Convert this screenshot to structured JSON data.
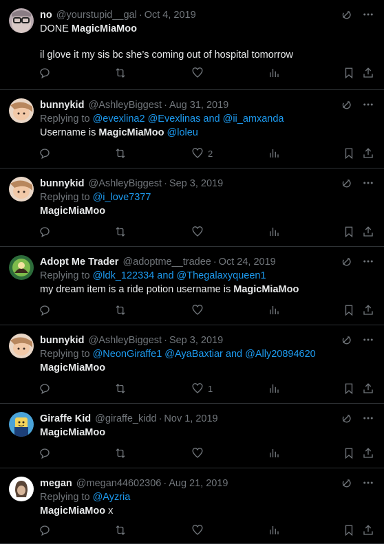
{
  "tweets": [
    {
      "name": "no",
      "handle": "@yourstupid__gal",
      "date": "Oct 4, 2019",
      "reply_prefix": "",
      "reply_to": "",
      "text_prefix": "DONE ",
      "text_bold": "MagicMiaMoo",
      "text_suffix": "",
      "text_line2": "il glove it my sis bc she’s coming out of hospital tomorrow",
      "likes": ""
    },
    {
      "name": "bunnykid",
      "handle": "@AshleyBiggest",
      "date": "Aug 31, 2019",
      "reply_prefix": "Replying to ",
      "reply_to": "@evexlina2 @Evexlinas and @ii_amxanda",
      "text_prefix": "Username is ",
      "text_bold": "MagicMiaMoo",
      "text_suffix": " @loleu",
      "text_line2": "",
      "likes": "2"
    },
    {
      "name": "bunnykid",
      "handle": "@AshleyBiggest",
      "date": "Sep 3, 2019",
      "reply_prefix": "Replying to ",
      "reply_to": "@i_love7377",
      "text_prefix": "",
      "text_bold": "MagicMiaMoo",
      "text_suffix": "",
      "text_line2": "",
      "likes": ""
    },
    {
      "name": "Adopt Me Trader",
      "handle": "@adoptme__tradee",
      "date": "Oct 24, 2019",
      "reply_prefix": "Replying to ",
      "reply_to": "@ldk_122334 and @Thegalaxyqueen1",
      "text_prefix": "my dream item is a ride potion username is ",
      "text_bold": "MagicMiaMoo",
      "text_suffix": "",
      "text_line2": "",
      "likes": ""
    },
    {
      "name": "bunnykid",
      "handle": "@AshleyBiggest",
      "date": "Sep 3, 2019",
      "reply_prefix": "Replying to ",
      "reply_to": "@NeonGiraffe1 @AyaBaxtiar and @Ally20894620",
      "text_prefix": "",
      "text_bold": "MagicMiaMoo",
      "text_suffix": "",
      "text_line2": "",
      "likes": "1"
    },
    {
      "name": "Giraffe Kid",
      "handle": "@giraffe_kidd",
      "date": "Nov 1, 2019",
      "reply_prefix": "",
      "reply_to": "",
      "text_prefix": "",
      "text_bold": "MagicMiaMoo",
      "text_suffix": "",
      "text_line2": "",
      "likes": ""
    },
    {
      "name": "megan",
      "handle": "@megan44602306",
      "date": "Aug 21, 2019",
      "reply_prefix": "Replying to ",
      "reply_to": "@Ayzria",
      "text_prefix": "",
      "text_bold": "MagicMiaMoo",
      "text_suffix": " x",
      "text_line2": "",
      "likes": ""
    }
  ],
  "icons": {
    "grok": "grok-icon",
    "more": "more-icon",
    "reply": "reply-icon",
    "retweet": "retweet-icon",
    "like": "like-icon",
    "views": "views-icon",
    "bookmark": "bookmark-icon",
    "share": "share-icon"
  },
  "colors": {
    "background": "#000000",
    "text": "#e7e9ea",
    "muted": "#71767b",
    "link": "#1d9bf0",
    "divider": "#2f3336"
  }
}
